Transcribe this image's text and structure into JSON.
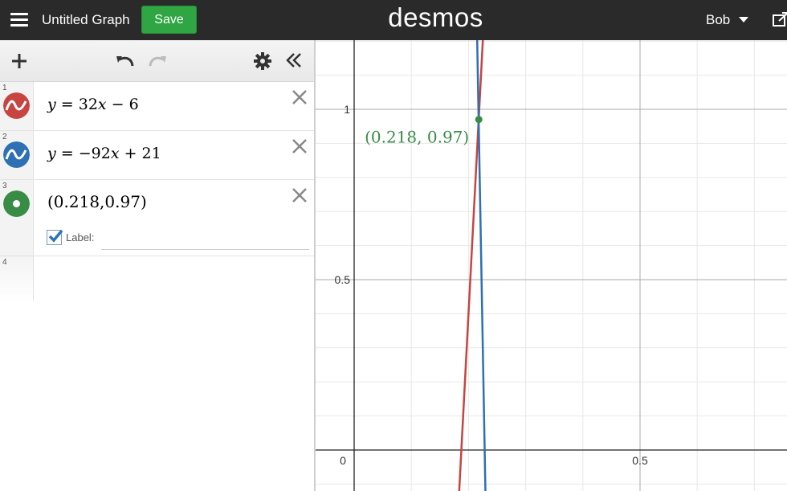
{
  "header": {
    "title": "Untitled Graph",
    "save_label": "Save",
    "logo": "desmos",
    "user": "Bob"
  },
  "expressions": [
    {
      "num": "1",
      "type": "line",
      "color": "#c74440",
      "latex": {
        "a": "y",
        "b": " = 32",
        "c": "x",
        "d": " − 6"
      }
    },
    {
      "num": "2",
      "type": "line",
      "color": "#2d70b3",
      "latex": {
        "a": "y",
        "b": " = −92",
        "c": "x",
        "d": " + 21"
      }
    },
    {
      "num": "3",
      "type": "point",
      "color": "#388c46",
      "text": "(0.218,0.97)",
      "label_option": "Label:",
      "label_checked": true
    },
    {
      "num": "4",
      "type": "empty"
    }
  ],
  "graph": {
    "x_ticks": [
      "0",
      "0.5"
    ],
    "y_ticks": [
      "0.5",
      "1"
    ],
    "point_label": "(0.218, 0.97)"
  },
  "chart_data": {
    "type": "line",
    "series": [
      {
        "name": "y = 32x − 6",
        "color": "#c74440",
        "slope": 32,
        "intercept": -6
      },
      {
        "name": "y = −92x + 21",
        "color": "#2d70b3",
        "slope": -92,
        "intercept": 21
      }
    ],
    "points": [
      {
        "x": 0.218,
        "y": 0.97,
        "label": "(0.218, 0.97)",
        "color": "#388c46"
      }
    ],
    "xlim": [
      -0.07,
      0.76
    ],
    "ylim": [
      -0.12,
      1.2
    ],
    "grid": true
  }
}
